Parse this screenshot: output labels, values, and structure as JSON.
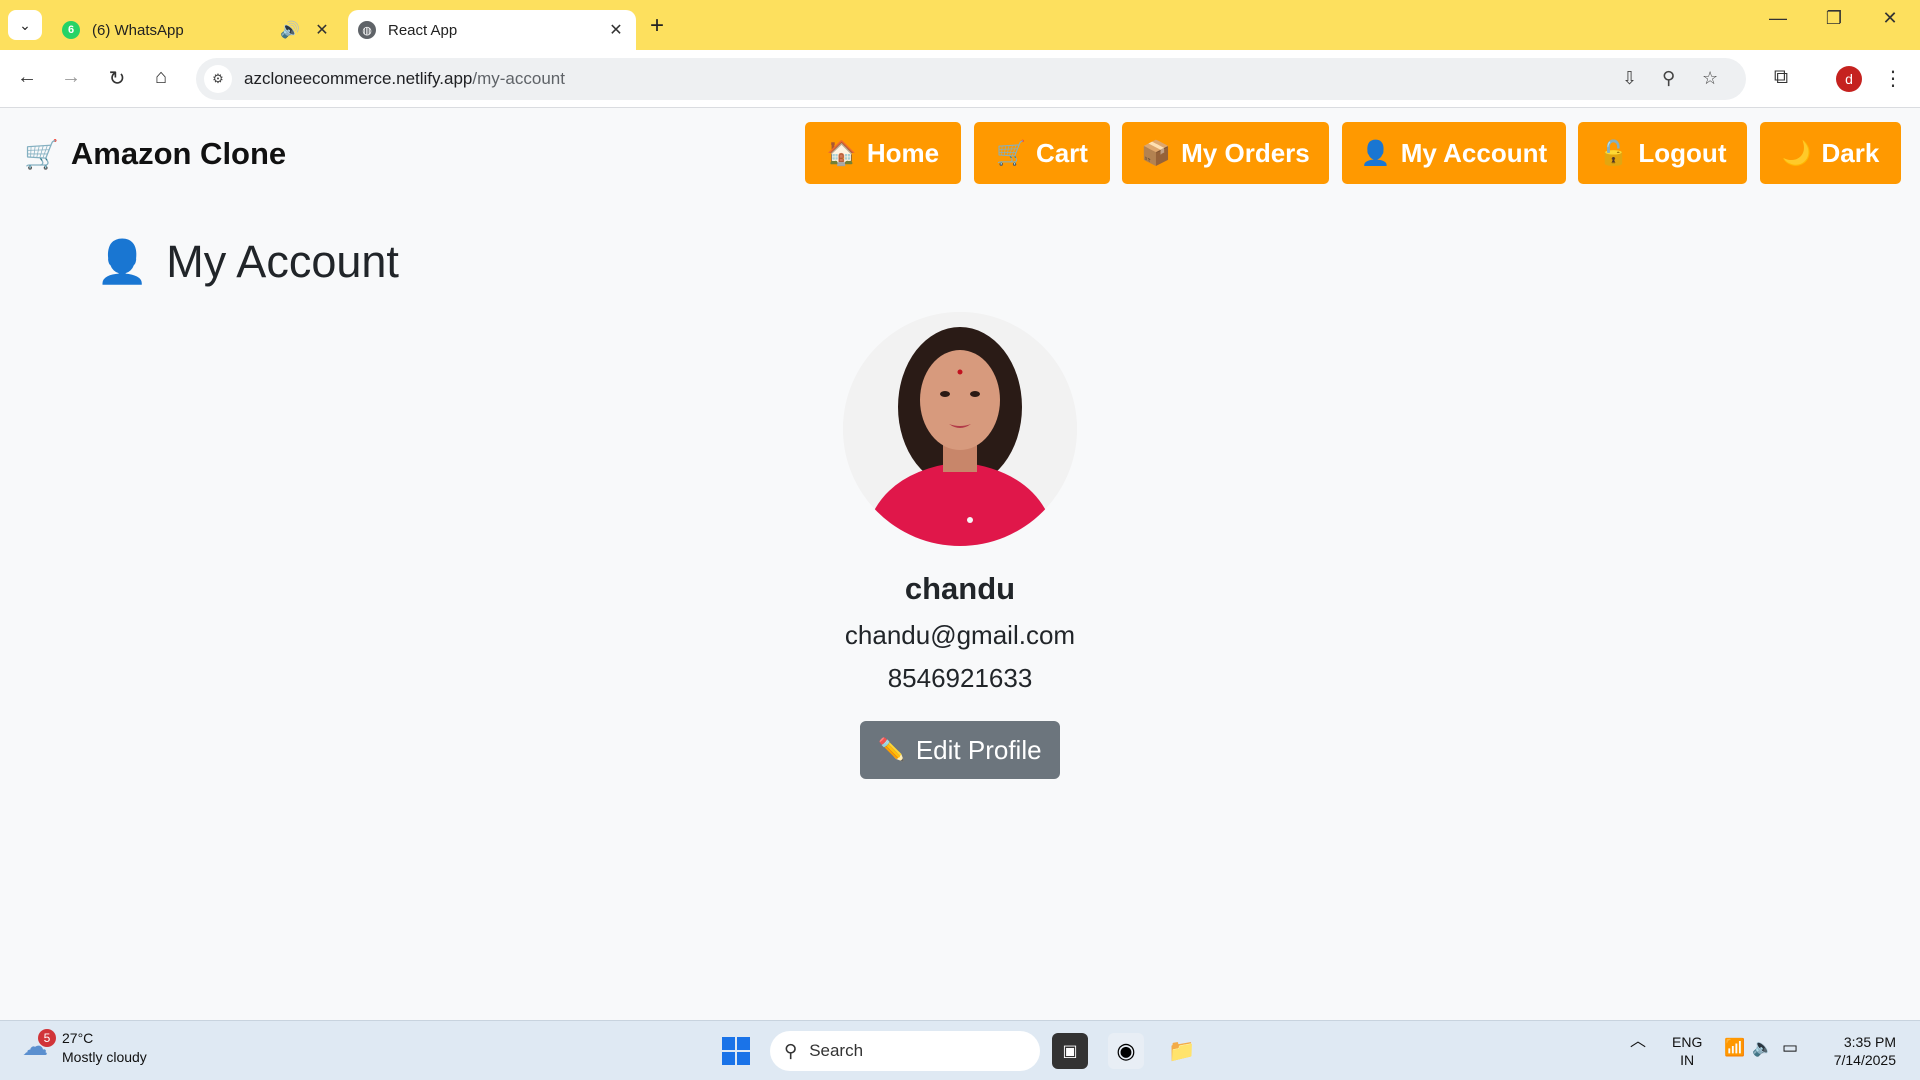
{
  "browser": {
    "tabs": [
      {
        "title": "(6) WhatsApp",
        "badge": "6"
      },
      {
        "title": "React App"
      }
    ],
    "url_host": "azcloneecommerce.netlify.app",
    "url_path": "/my-account",
    "profile_initial": "d"
  },
  "app": {
    "brand": "Amazon Clone",
    "brand_icon": "shopping-cart-icon",
    "nav": [
      {
        "label": "Home",
        "icon": "house-icon",
        "glyph": "🏠"
      },
      {
        "label": "Cart",
        "icon": "cart-icon",
        "glyph": "🛒"
      },
      {
        "label": "My Orders",
        "icon": "package-icon",
        "glyph": "📦"
      },
      {
        "label": "My Account",
        "icon": "user-icon",
        "glyph": "👤"
      },
      {
        "label": "Logout",
        "icon": "unlock-icon",
        "glyph": "🔓"
      },
      {
        "label": "Dark",
        "icon": "moon-icon",
        "glyph": "🌙"
      }
    ],
    "page_title": "My Account",
    "user": {
      "name": "chandu",
      "email": "chandu@gmail.com",
      "phone": "8546921633"
    },
    "edit_button": "Edit Profile",
    "accent_color": "#ff9900",
    "secondary_color": "#6c757d"
  },
  "taskbar": {
    "weather_badge": "5",
    "temperature": "27°C",
    "condition": "Mostly cloudy",
    "search_placeholder": "Search",
    "language": "ENG",
    "region": "IN",
    "time": "3:35 PM",
    "date": "7/14/2025"
  }
}
